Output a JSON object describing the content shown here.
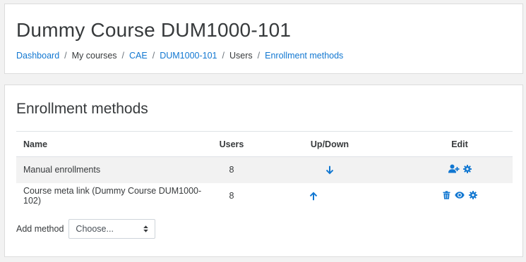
{
  "course": {
    "title": "Dummy Course DUM1000-101"
  },
  "breadcrumb": [
    {
      "label": "Dashboard",
      "link": true
    },
    {
      "label": "My courses",
      "link": false
    },
    {
      "label": "CAE",
      "link": true
    },
    {
      "label": "DUM1000-101",
      "link": true
    },
    {
      "label": "Users",
      "link": false
    },
    {
      "label": "Enrollment methods",
      "link": true
    }
  ],
  "section": {
    "title": "Enrollment methods"
  },
  "table": {
    "headers": {
      "name": "Name",
      "users": "Users",
      "updown": "Up/Down",
      "edit": "Edit"
    },
    "rows": [
      {
        "name": "Manual enrollments",
        "users": "8",
        "move_icon": "arrow-down-icon",
        "edit_icons": [
          "enrol-users-icon",
          "settings-gear-icon"
        ]
      },
      {
        "name": "Course meta link (Dummy Course DUM1000-102)",
        "users": "8",
        "move_icon": "arrow-up-icon",
        "edit_icons": [
          "trash-icon",
          "eye-icon",
          "settings-gear-icon"
        ]
      }
    ]
  },
  "add_method": {
    "label": "Add method",
    "selected": "Choose..."
  },
  "colors": {
    "link": "#1177d1",
    "text": "#373a3c",
    "stripe": "#f2f2f2",
    "background": "#f2f2f2"
  }
}
